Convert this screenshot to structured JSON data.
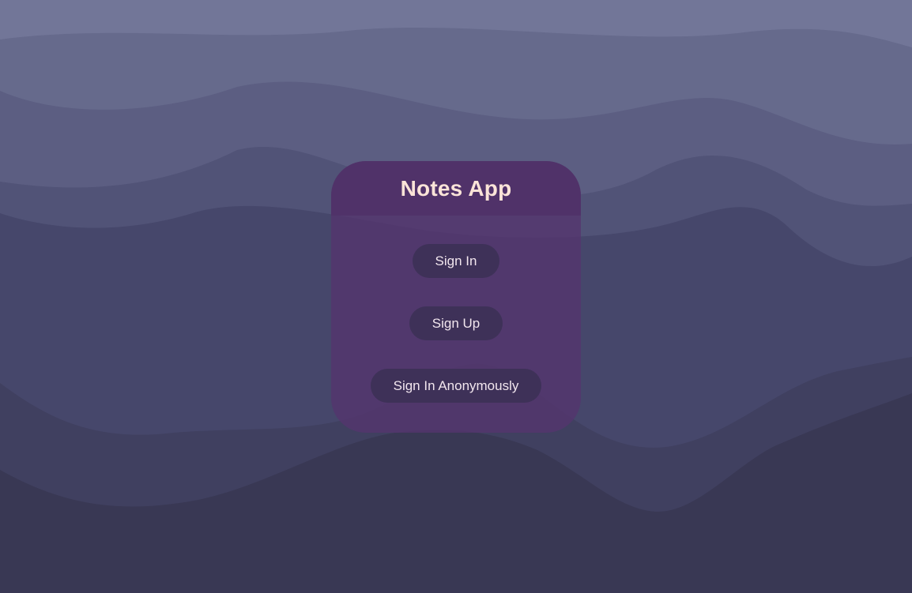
{
  "app": {
    "title": "Notes App"
  },
  "auth": {
    "sign_in_label": "Sign In",
    "sign_up_label": "Sign Up",
    "anonymous_label": "Sign In Anonymously"
  },
  "colors": {
    "background_top": "#727698",
    "background_bottom": "#393854",
    "card": "#54346e",
    "button": "#3e3158",
    "title_text": "#fbe4d8"
  }
}
